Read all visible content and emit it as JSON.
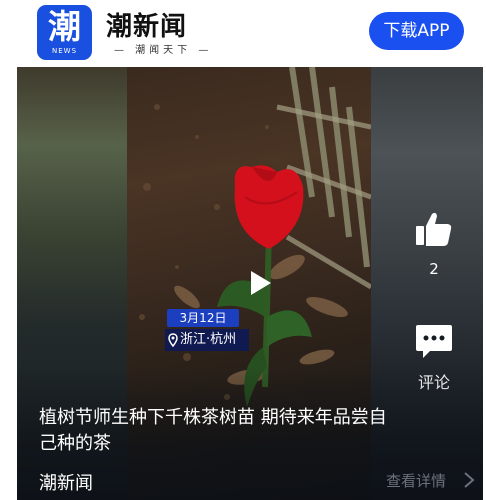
{
  "header": {
    "logo_glyph": "潮",
    "logo_sub": "NEWS",
    "brand_name": "潮新闻",
    "slogan": "— 潮闻天下 —",
    "download_label": "下载APP"
  },
  "video": {
    "date_tag": "3月12日",
    "location_tag": "浙江·杭州",
    "like_count": "2",
    "comment_label": "评论",
    "title": "植树节师生种下千株茶树苗 期待来年品尝自己种的茶",
    "source": "潮新闻",
    "detail_label": "查看详情"
  },
  "colors": {
    "brand_blue": "#1a50df",
    "button_blue": "#1a4ff0",
    "tulip_red": "#d4101c"
  }
}
